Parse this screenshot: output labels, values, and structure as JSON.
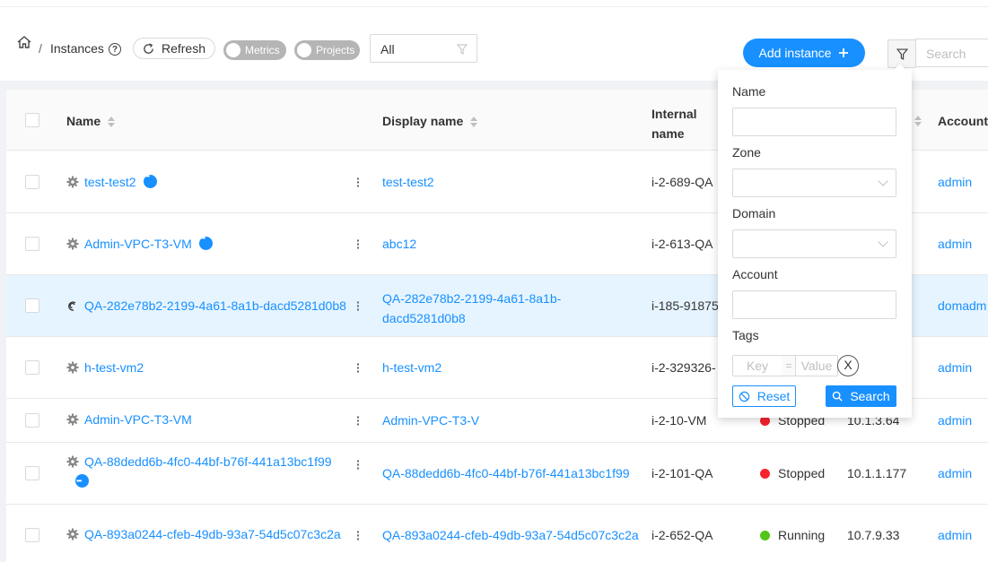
{
  "breadcrumb": {
    "separator": "/",
    "title": "Instances"
  },
  "toolbar": {
    "refresh_label": "Refresh",
    "metrics_label": "Metrics",
    "projects_label": "Projects",
    "filter_value": "All",
    "add_label": "Add instance",
    "search_placeholder": "Search"
  },
  "table": {
    "headers": {
      "name": "Name",
      "display_name": "Display name",
      "internal_name_1": "Internal",
      "internal_name_2": "name",
      "account": "Account"
    },
    "rows": [
      {
        "name": "test-test2",
        "display": "test-test2",
        "display2": "",
        "internal": "i-2-689-QA",
        "state": "",
        "ip": "",
        "account": "admin"
      },
      {
        "name": "Admin-VPC-T3-VM",
        "display": "abc12",
        "display2": "",
        "internal": "i-2-613-QA",
        "state": "",
        "ip": "",
        "account": "admin"
      },
      {
        "name": "QA-282e78b2-2199-4a61-8a1b-dacd5281d0b8",
        "display": "QA-282e78b2-2199-4a61-8a1b-",
        "display2": "dacd5281d0b8",
        "internal": "i-185-91875",
        "state": "",
        "ip": "",
        "account": "domadm"
      },
      {
        "name": "h-test-vm2",
        "display": "h-test-vm2",
        "display2": "",
        "internal": "i-2-329326-",
        "state": "",
        "ip": "",
        "account": "admin"
      },
      {
        "name": "Admin-VPC-T3-VM",
        "display": "Admin-VPC-T3-V",
        "display2": "",
        "internal": "i-2-10-VM",
        "state": "Stopped",
        "ip": "10.1.3.64",
        "account": "admin"
      },
      {
        "name": "QA-88dedd6b-4fc0-44bf-b76f-441a13bc1f99",
        "display": "QA-88dedd6b-4fc0-44bf-b76f-441a13bc1f99",
        "display2": "",
        "internal": "i-2-101-QA",
        "state": "Stopped",
        "ip": "10.1.1.177",
        "account": "admin"
      },
      {
        "name": "QA-893a0244-cfeb-49db-93a7-54d5c07c3c2a",
        "display": "QA-893a0244-cfeb-49db-93a7-54d5c07c3c2a",
        "display2": "",
        "internal": "i-2-652-QA",
        "state": "Running",
        "ip": "10.7.9.33",
        "account": "admin"
      }
    ]
  },
  "filter_popover": {
    "name_label": "Name",
    "zone_label": "Zone",
    "domain_label": "Domain",
    "account_label": "Account",
    "tags_label": "Tags",
    "key_placeholder": "Key",
    "equals": "=",
    "value_placeholder": "Value",
    "clear_symbol": "X",
    "reset_label": "Reset",
    "search_label": "Search"
  },
  "colors": {
    "primary": "#1890ff",
    "stopped": "#f5222d",
    "running": "#52c41a",
    "selected_row": "#e6f4ff"
  }
}
